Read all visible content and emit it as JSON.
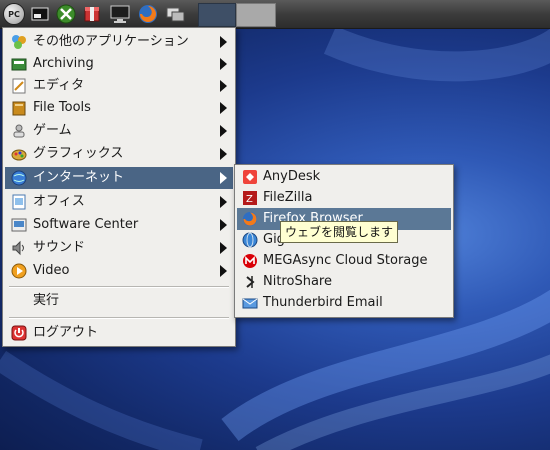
{
  "taskbar": {
    "start_label": "PC",
    "launchers": [
      "xterm-icon",
      "xfce-green-icon",
      "package-icon",
      "monitor-icon",
      "firefox-icon",
      "windows-icon"
    ]
  },
  "main_menu": {
    "items": [
      {
        "label": "その他のアプリケーション",
        "icon": "other-apps-icon",
        "submenu": true
      },
      {
        "label": "Archiving",
        "icon": "archive-icon",
        "submenu": true
      },
      {
        "label": "エディタ",
        "icon": "editor-icon",
        "submenu": true
      },
      {
        "label": "File Tools",
        "icon": "file-tools-icon",
        "submenu": true
      },
      {
        "label": "ゲーム",
        "icon": "games-icon",
        "submenu": true
      },
      {
        "label": "グラフィックス",
        "icon": "graphics-icon",
        "submenu": true
      },
      {
        "label": "インターネット",
        "icon": "internet-icon",
        "submenu": true,
        "selected": true
      },
      {
        "label": "オフィス",
        "icon": "office-icon",
        "submenu": true
      },
      {
        "label": "Software Center",
        "icon": "software-center-icon",
        "submenu": true
      },
      {
        "label": "サウンド",
        "icon": "sound-icon",
        "submenu": true
      },
      {
        "label": "Video",
        "icon": "video-icon",
        "submenu": true
      }
    ],
    "run_label": "実行",
    "logout_label": "ログアウト"
  },
  "internet_submenu": {
    "items": [
      {
        "label": "AnyDesk",
        "icon": "anydesk-icon"
      },
      {
        "label": "FileZilla",
        "icon": "filezilla-icon"
      },
      {
        "label": "Firefox Browser",
        "icon": "firefox-icon",
        "selected": true
      },
      {
        "label": "Gigolo",
        "icon": "gigolo-icon"
      },
      {
        "label": "MEGAsync Cloud Storage",
        "icon": "mega-icon"
      },
      {
        "label": "NitroShare",
        "icon": "nitroshare-icon"
      },
      {
        "label": "Thunderbird Email",
        "icon": "thunderbird-icon"
      }
    ]
  },
  "tooltip": "ウェブを閲覧します",
  "colors": {
    "menu_bg": "#f0efec",
    "selection": "#4a6585",
    "tooltip_bg": "#ffffd2",
    "desktop": "#1c3a8c"
  }
}
